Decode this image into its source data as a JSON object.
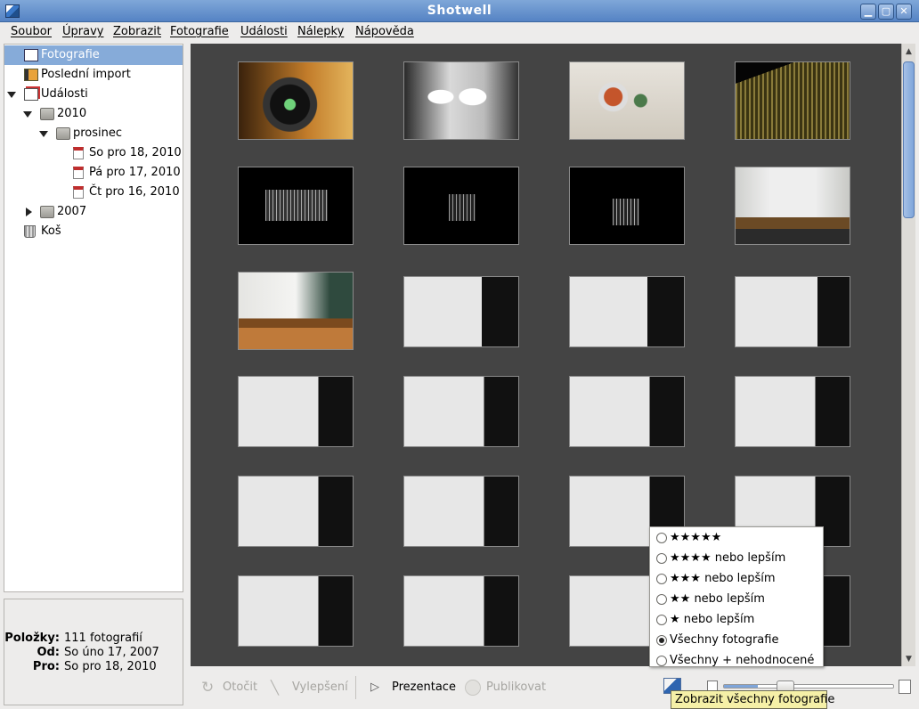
{
  "window": {
    "title": "Shotwell"
  },
  "menu": [
    "Soubor",
    "Úpravy",
    "Zobrazit",
    "Fotografie",
    "Události",
    "Nálepky",
    "Nápověda"
  ],
  "sidebar": {
    "photos": "Fotografie",
    "last_import": "Poslední import",
    "events": "Události",
    "year_2010": "2010",
    "month_dec": "prosinec",
    "days": [
      "So pro 18, 2010",
      "Pá pro 17, 2010",
      "Čt pro 16, 2010"
    ],
    "year_2007": "2007",
    "trash": "Koš"
  },
  "info": {
    "items_label": "Položky:",
    "items_value": "111 fotografií",
    "from_label": "Od:",
    "from_value": "So úno 17, 2007",
    "to_label": "Pro:",
    "to_value": "So pro 18, 2010"
  },
  "toolbar": {
    "rotate": "Otočit",
    "enhance": "Vylepšení",
    "slideshow": "Prezentace",
    "publish": "Publikovat"
  },
  "rating_filter": {
    "options": [
      "★★★★★",
      "★★★★ nebo lepším",
      "★★★ nebo lepším",
      "★★ nebo lepším",
      "★ nebo lepším",
      "Všechny fotografie",
      "Všechny + nehodnocené"
    ],
    "selected_index": 5
  },
  "tooltip": "Zobrazit všechny fotografie",
  "zoom_level": 0.2
}
